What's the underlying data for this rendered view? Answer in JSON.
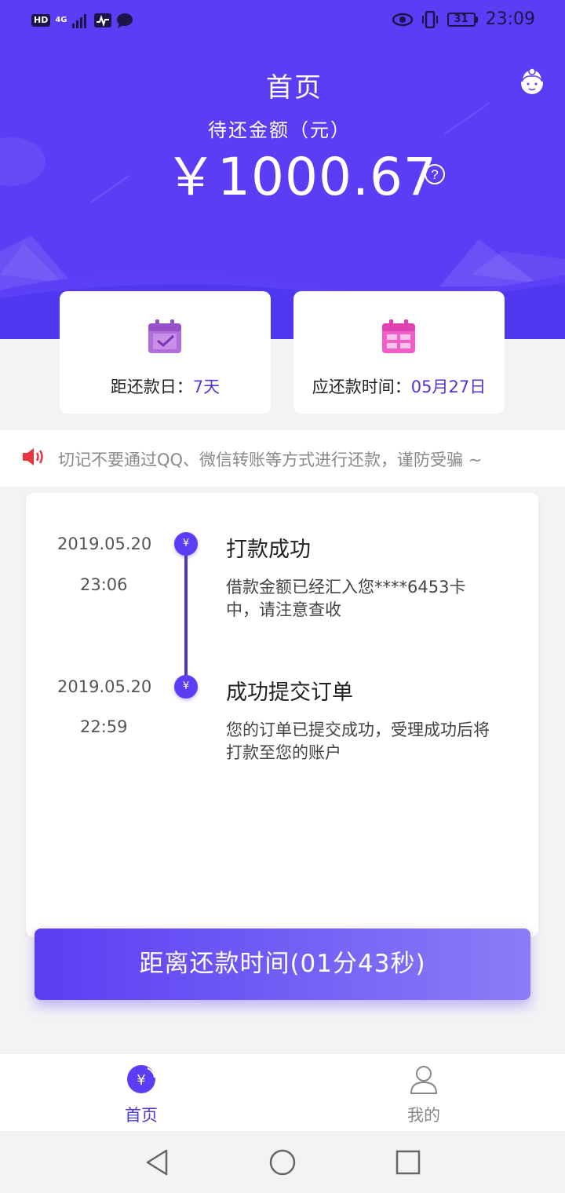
{
  "status_bar": {
    "hd": "HD",
    "network": "4G",
    "battery": "31",
    "time": "23:09"
  },
  "header": {
    "title": "首页",
    "amount_label": "待还金额（元）",
    "amount_value": "￥1000.67"
  },
  "cards": {
    "due_days_label": "距还款日：",
    "due_days_value": "7天",
    "due_date_label": "应还款时间：",
    "due_date_value": "05月27日"
  },
  "notice": {
    "text": "切记不要通过QQ、微信转账等方式进行还款，谨防受骗 ~"
  },
  "timeline": {
    "events": [
      {
        "date": "2019.05.20",
        "time": "23:06",
        "title": "打款成功",
        "description": "借款金额已经汇入您****6453卡中，请注意查收"
      },
      {
        "date": "2019.05.20",
        "time": "22:59",
        "title": "成功提交订单",
        "description": "您的订单已提交成功，受理成功后将打款至您的账户"
      }
    ],
    "dot_symbol": "¥"
  },
  "countdown": {
    "label": "距离还款时间(01分43秒)"
  },
  "tabbar": {
    "home_label": "首页",
    "me_label": "我的"
  },
  "colors": {
    "primary": "#5b3df5",
    "accent_text": "#4a39d8",
    "card_icon_purple": "#b26ddd",
    "card_icon_pink": "#f25ec8",
    "speaker_red": "#e8353b"
  }
}
